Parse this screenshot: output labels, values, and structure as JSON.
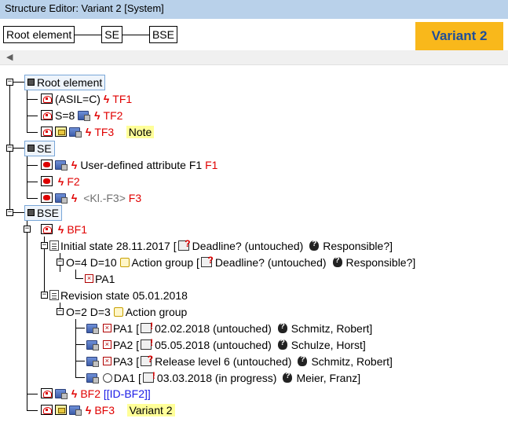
{
  "window": {
    "title": "Structure Editor: Variant 2 [System]"
  },
  "breadcrumb": {
    "items": [
      "Root element",
      "SE",
      "BSE"
    ]
  },
  "variant_badge": "Variant 2",
  "colors": {
    "title_bar": "#b9d1ea",
    "badge_bg": "#f9b81b",
    "badge_text": "#1f4e9a",
    "fault_red": "#e00000",
    "highlight": "#ffff99"
  },
  "tree": {
    "root": {
      "label": "Root element",
      "children": [
        {
          "cond": "(ASIL=C)",
          "fault": "TF1"
        },
        {
          "cond": "S=8",
          "fault": "TF2"
        },
        {
          "fault": "TF3",
          "note": "Note"
        }
      ]
    },
    "se": {
      "label": "SE",
      "children": [
        {
          "text": "User-defined attribute F1",
          "fault": "F1"
        },
        {
          "fault": "F2"
        },
        {
          "text": "<Kl.-F3>",
          "fault": "F3"
        }
      ]
    },
    "bse": {
      "label": "BSE",
      "bf1": {
        "fault": "BF1",
        "initial_state": {
          "label": "Initial state 28.11.2017",
          "deadline": "Deadline? (untouched)",
          "responsible": "Responsible?]",
          "group": {
            "od": "O=4 D=10",
            "label": "Action group",
            "deadline": "Deadline? (untouched)",
            "responsible": "Responsible?]",
            "items": [
              {
                "label": "PA1"
              }
            ]
          }
        },
        "revision_state": {
          "label": "Revision state 05.01.2018",
          "group": {
            "od": "O=2 D=3",
            "label": "Action group",
            "items": [
              {
                "label": "PA1",
                "deadline": "02.02.2018 (untouched)",
                "responsible": "Schmitz, Robert]"
              },
              {
                "label": "PA2",
                "deadline": "05.05.2018 (untouched)",
                "responsible": "Schulze, Horst]"
              },
              {
                "label": "PA3",
                "deadline": "Release level 6 (untouched)",
                "responsible": "Schmitz, Robert]"
              },
              {
                "label": "DA1",
                "deadline": "03.03.2018 (in progress)",
                "responsible": "Meier, Franz]"
              }
            ]
          }
        }
      },
      "bf2": {
        "fault": "BF2",
        "link": "[[ID-BF2]]"
      },
      "bf3": {
        "fault": "BF3",
        "variant": "Variant 2"
      }
    }
  }
}
